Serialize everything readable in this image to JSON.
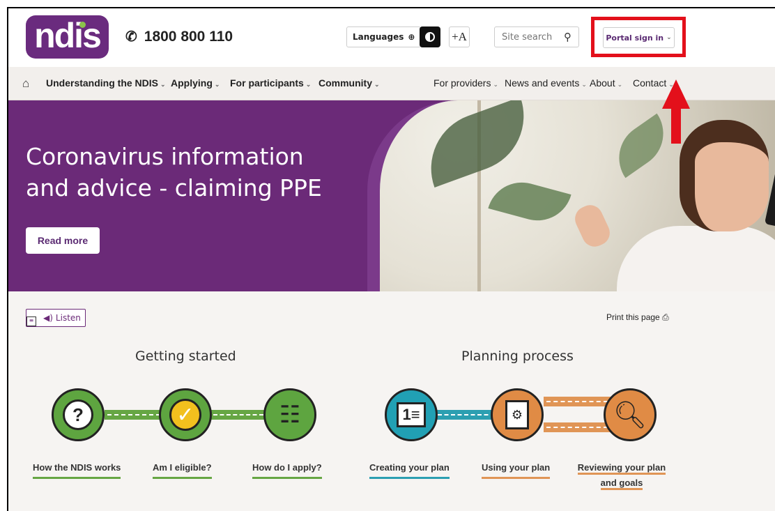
{
  "header": {
    "logo_text": "ndis",
    "phone": "1800 800 110",
    "languages_label": "Languages",
    "text_size_label": "+A",
    "search_placeholder": "Site search",
    "portal_label": "Portal sign in"
  },
  "nav": {
    "items": [
      {
        "label": "Understanding the NDIS"
      },
      {
        "label": "Applying"
      },
      {
        "label": "For participants"
      },
      {
        "label": "Community"
      },
      {
        "label": "For providers"
      },
      {
        "label": "News and events"
      },
      {
        "label": "About"
      },
      {
        "label": "Contact"
      }
    ]
  },
  "hero": {
    "title": "Coronavirus information and advice - claiming PPE",
    "button_label": "Read more"
  },
  "tools": {
    "listen_label": "Listen",
    "print_label": "Print this page"
  },
  "sections": {
    "getting_started": "Getting started",
    "planning_process": "Planning process"
  },
  "steps": [
    {
      "label": "How the NDIS works",
      "icon": "question-bubble-icon"
    },
    {
      "label": "Am I eligible?",
      "icon": "checkmark-icon"
    },
    {
      "label": "How do I apply?",
      "icon": "people-form-icon"
    },
    {
      "label": "Creating your plan",
      "icon": "folder-document-icon"
    },
    {
      "label": "Using your plan",
      "icon": "document-gear-icon"
    },
    {
      "label": "Reviewing your plan and goals",
      "line1": "Reviewing your plan",
      "line2": "and goals",
      "icon": "magnifier-review-icon"
    }
  ],
  "colors": {
    "brand_purple": "#6b2a78",
    "accent_green": "#66a644",
    "accent_teal": "#2c9fb1",
    "accent_orange": "#e09556",
    "annotation_red": "#e3101b"
  }
}
